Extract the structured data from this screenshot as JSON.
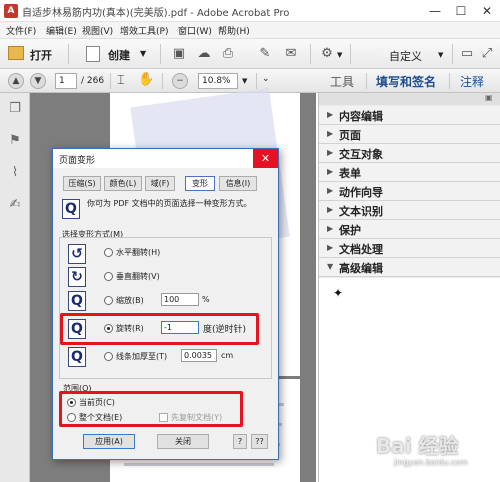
{
  "window": {
    "title": "自适步林易筋内功(真本)(完美版).pdf - Adobe Acrobat Pro",
    "app_icon": "acrobat-icon",
    "min": "—",
    "max": "☐",
    "close": "✕"
  },
  "menu": [
    "文件(F)",
    "编辑(E)",
    "视图(V)",
    "增效工具(P)",
    "窗口(W)",
    "帮助(H)"
  ],
  "toolbar": {
    "open_label": "打开",
    "create_label": "创建",
    "customize_label": "自定义"
  },
  "nav": {
    "page_current": "1",
    "page_total": "/ 266",
    "zoom": "10.8%",
    "tools_tab": "工具",
    "sign_tab": "填写和签名",
    "comment_tab": "注释"
  },
  "right_panel": {
    "sections": [
      "内容编辑",
      "页面",
      "交互对象",
      "表单",
      "动作向导",
      "文本识别",
      "保护",
      "文档处理",
      "高级编辑"
    ],
    "expanded_index": 8
  },
  "dialog": {
    "title": "页面变形",
    "tabs": [
      "压缩(S)",
      "颜色(L)",
      "域(F)",
      "变形",
      "信息(I)"
    ],
    "active_tab": 3,
    "description": "你可为 PDF 文档中的页面选择一种变形方式。",
    "group_label": "选择变形方式(M)",
    "options": {
      "flip_h": "水平翻转(H)",
      "flip_v": "垂直翻转(V)",
      "scale": "缩放(B)",
      "scale_value": "100",
      "scale_unit": "%",
      "rotate": "旋转(R)",
      "rotate_value": "-1",
      "rotate_unit": "度(逆时针)",
      "stroke": "线条加厚至(T)",
      "stroke_value": "0.0035",
      "stroke_unit": "cm"
    },
    "range": {
      "label": "范围(O)",
      "current_page": "当前页(C)",
      "whole_doc": "整个文档(E)",
      "copy_doc": "先复制文档(Y)"
    },
    "buttons": {
      "apply": "应用(A)",
      "close": "关闭",
      "help": "?",
      "help2": "??"
    }
  },
  "watermark": {
    "brand": "Bai 经验",
    "url": "jingyan.baidu.com"
  },
  "colors": {
    "accent_blue": "#1d4f91",
    "highlight_red": "#e3141c"
  }
}
